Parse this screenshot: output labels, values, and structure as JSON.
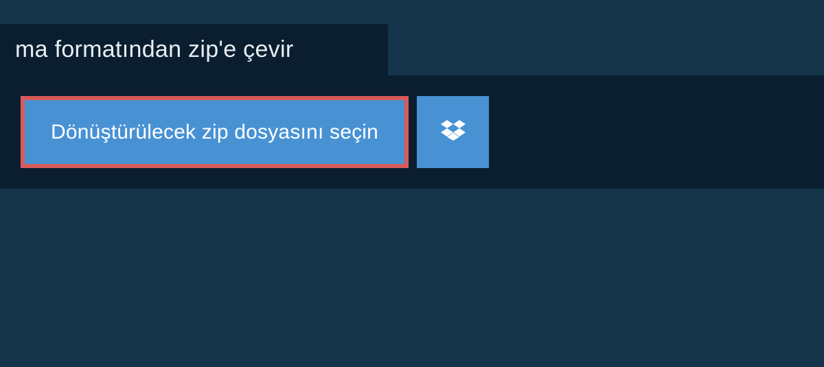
{
  "header": {
    "title": "ma formatından zip'e çevir"
  },
  "actions": {
    "select_file_label": "Dönüştürülecek zip dosyasını seçin"
  },
  "colors": {
    "background": "#14344a",
    "panel": "#0a1e30",
    "button_primary": "#4892d4",
    "button_highlight_border": "#d85a5a"
  }
}
